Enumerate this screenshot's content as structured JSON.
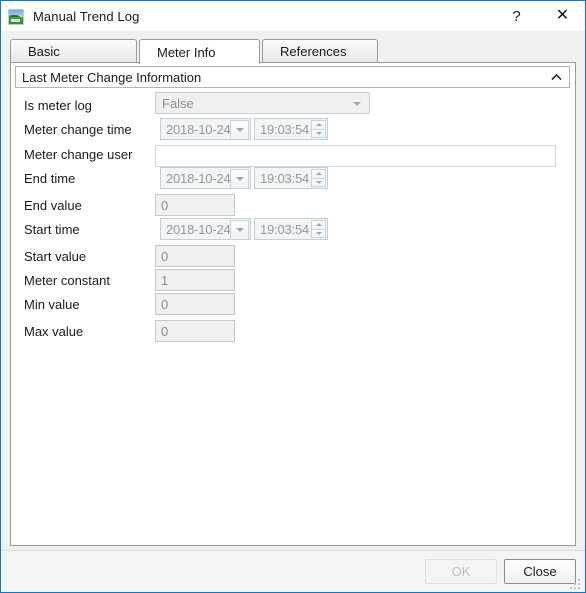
{
  "window": {
    "title": "Manual Trend Log",
    "icon": "trend-log-app-icon",
    "help_label": "?",
    "close_label": "✕",
    "border_color": "#0a7ac8"
  },
  "tabs": [
    {
      "label": "Basic",
      "selected": false
    },
    {
      "label": "Meter Info",
      "selected": true
    },
    {
      "label": "References",
      "selected": false
    }
  ],
  "group": {
    "title": "Last Meter Change Information",
    "collapse_icon": "chevron-up-icon",
    "expanded": true
  },
  "fields": {
    "is_meter_log": {
      "label": "Is meter log",
      "value": "False",
      "type": "combobox",
      "disabled": true
    },
    "meter_change_time": {
      "label": "Meter change time",
      "date": "2018-10-24",
      "time": "19:03:54",
      "type": "datetime",
      "disabled": true
    },
    "meter_change_user": {
      "label": "Meter change user",
      "value": "",
      "placeholder": "",
      "type": "text",
      "disabled": false
    },
    "end_time": {
      "label": "End time",
      "date": "2018-10-24",
      "time": "19:03:54",
      "type": "datetime",
      "disabled": true
    },
    "end_value": {
      "label": "End value",
      "value": "0",
      "type": "number",
      "disabled": true
    },
    "start_time": {
      "label": "Start time",
      "date": "2018-10-24",
      "time": "19:03:54",
      "type": "datetime",
      "disabled": true
    },
    "start_value": {
      "label": "Start value",
      "value": "0",
      "type": "number",
      "disabled": true
    },
    "meter_constant": {
      "label": "Meter constant",
      "value": "1",
      "type": "number",
      "disabled": true
    },
    "min_value": {
      "label": "Min value",
      "value": "0",
      "type": "number",
      "disabled": true
    },
    "max_value": {
      "label": "Max value",
      "value": "0",
      "type": "number",
      "disabled": true
    }
  },
  "footer": {
    "ok_label": "OK",
    "ok_disabled": true,
    "close_label": "Close",
    "close_disabled": false,
    "resize_grip_icon": "resize-grip-icon"
  }
}
